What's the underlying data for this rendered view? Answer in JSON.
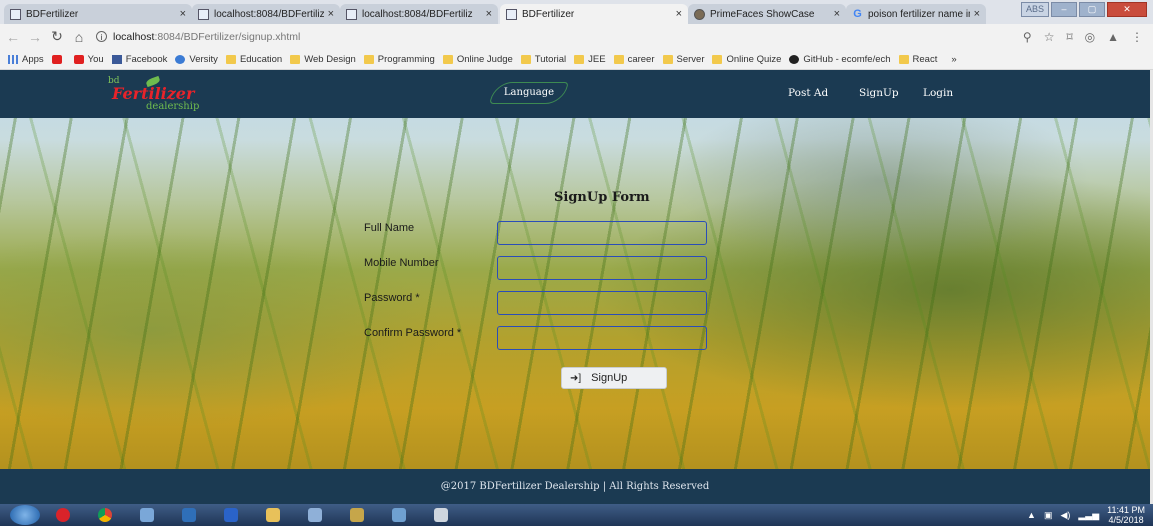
{
  "browser": {
    "tabs": [
      {
        "title": "BDFertilizer",
        "active": false,
        "icon": "page-icon"
      },
      {
        "title": "localhost:8084/BDFertiliz",
        "active": false,
        "icon": "page-icon"
      },
      {
        "title": "localhost:8084/BDFertiliz",
        "active": false,
        "icon": "page-icon"
      },
      {
        "title": "BDFertilizer",
        "active": true,
        "icon": "page-icon"
      },
      {
        "title": "PrimeFaces ShowCase",
        "active": false,
        "icon": "primefaces-icon"
      },
      {
        "title": "poison fertilizer name in",
        "active": false,
        "icon": "google-icon"
      }
    ],
    "window_buttons": {
      "abs": "ABS",
      "minimize": "–",
      "maximize": "▢",
      "close": "✕"
    },
    "url": {
      "host": "localhost",
      "path": ":8084/BDFertilizer/signup.xhtml"
    },
    "bookmarks": [
      {
        "label": "Apps",
        "icon": "apps"
      },
      {
        "label": "",
        "icon": "yt"
      },
      {
        "label": "You",
        "icon": "yt"
      },
      {
        "label": "Facebook",
        "icon": "fb"
      },
      {
        "label": "Versity",
        "icon": "vs"
      },
      {
        "label": "Education",
        "icon": "folder"
      },
      {
        "label": "Web Design",
        "icon": "folder"
      },
      {
        "label": "Programming",
        "icon": "folder"
      },
      {
        "label": "Online Judge",
        "icon": "folder"
      },
      {
        "label": "Tutorial",
        "icon": "folder"
      },
      {
        "label": "JEE",
        "icon": "folder"
      },
      {
        "label": "career",
        "icon": "folder"
      },
      {
        "label": "Server",
        "icon": "folder"
      },
      {
        "label": "Online Quize",
        "icon": "folder"
      },
      {
        "label": "GitHub - ecomfe/ech",
        "icon": "gh"
      },
      {
        "label": "React",
        "icon": "folder"
      }
    ],
    "bookmarks_more": "»"
  },
  "site": {
    "logo": {
      "top": "bd",
      "main": "Fertilizer",
      "sub": "dealership"
    },
    "nav": {
      "language": "Language",
      "post_ad": "Post Ad",
      "signup": "SignUp",
      "login": "Login"
    },
    "form": {
      "title": "SignUp Form",
      "fields": [
        {
          "label": "Full Name",
          "value": ""
        },
        {
          "label": "Mobile Number",
          "value": ""
        },
        {
          "label": "Password *",
          "value": ""
        },
        {
          "label": "Confirm Password *",
          "value": ""
        }
      ],
      "submit": "SignUp"
    },
    "footer": "@2017 BDFertilizer Dealership | All Rights Reserved"
  },
  "taskbar": {
    "clock_time": "11:41 PM",
    "clock_date": "4/5/2018"
  },
  "colors": {
    "navbar": "#1b3a52",
    "input_border": "#2a4db8",
    "logo_red": "#e8232a",
    "logo_green": "#6fbb4e"
  }
}
